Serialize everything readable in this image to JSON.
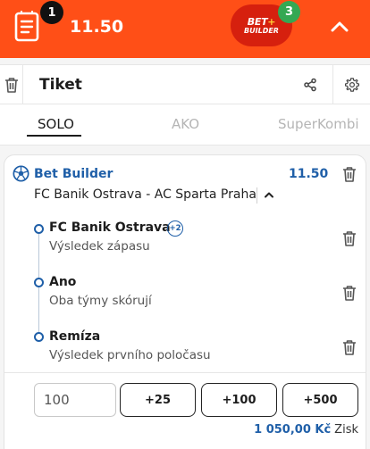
{
  "topbar": {
    "ticket_count": "1",
    "total_odds": "11.50",
    "bet_builder_logo": {
      "line1": "BET",
      "plus": "+",
      "line2": "BUILDER"
    },
    "bet_builder_count": "3",
    "bg_color": "#ff4f17"
  },
  "header": {
    "title": "Tiket"
  },
  "tabs": [
    {
      "label": "SOLO",
      "active": true
    },
    {
      "label": "AKO",
      "active": false
    },
    {
      "label": "SuperKombi",
      "active": false
    }
  ],
  "card": {
    "title": "Bet Builder",
    "odds": "11.50",
    "match": "FC Banik Ostrava - AC Sparta Praha",
    "extra_badge": "+2",
    "selections": [
      {
        "name": "FC Banik Ostrava",
        "market": "Výsledek zápasu"
      },
      {
        "name": "Ano",
        "market": "Oba týmy skórují"
      },
      {
        "name": "Remíza",
        "market": "Výsledek prvního poločasu"
      }
    ],
    "stake_value": "100",
    "quick_stakes": [
      "+25",
      "+100",
      "+500"
    ],
    "win_amount": "1 050,00 Kč",
    "win_label": "Zisk",
    "accent_color": "#1f5fa8"
  }
}
